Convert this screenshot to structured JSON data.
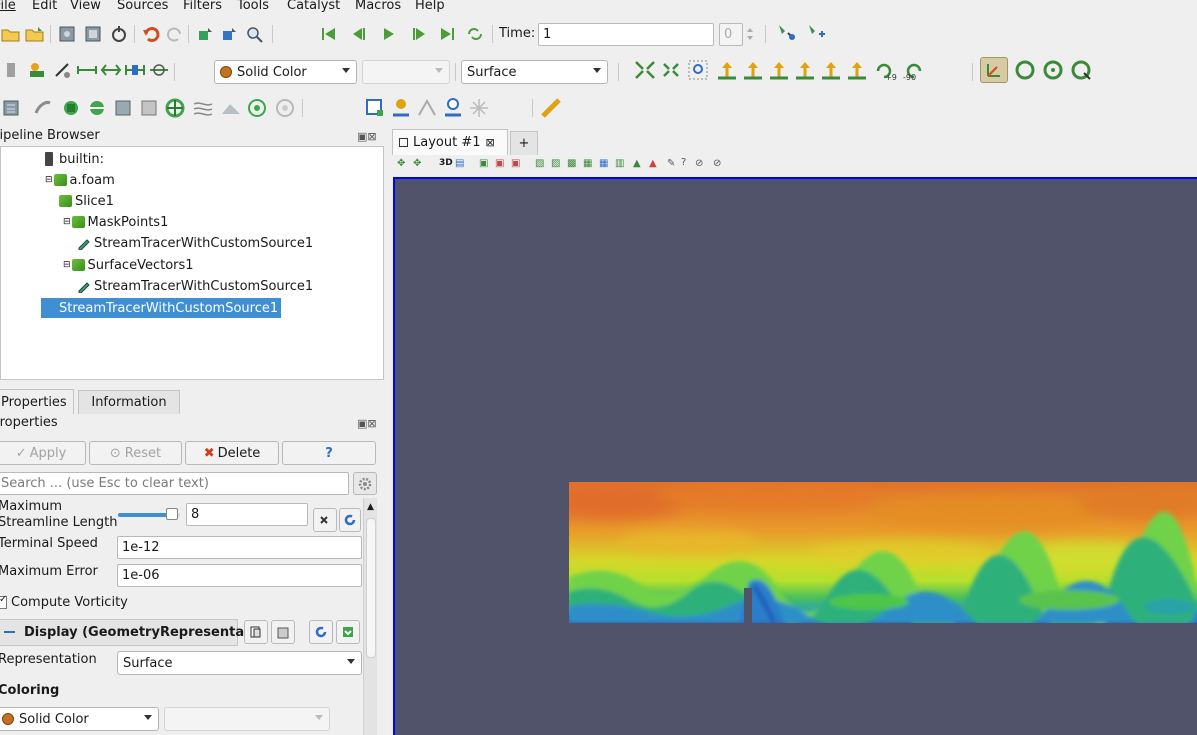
{
  "menu": [
    "File",
    "Edit",
    "View",
    "Sources",
    "Filters",
    "Tools",
    "Catalyst",
    "Macros",
    "Help"
  ],
  "toolbar": {
    "time_label": "Time:",
    "time_value": "1",
    "timestep_value": "0",
    "coloring_value": "Solid Color",
    "representation_value": "Surface",
    "rotate_plus": "+90",
    "rotate_minus": "-90"
  },
  "pipeline": {
    "title": "Pipeline Browser",
    "nodes": [
      "builtin:",
      "a.foam",
      "Slice1",
      "MaskPoints1",
      "StreamTracerWithCustomSource1",
      "SurfaceVectors1",
      "StreamTracerWithCustomSource1",
      "StreamTracerWithCustomSource1"
    ]
  },
  "layout_tabs": {
    "tab1": "Layout #1",
    "add": "+"
  },
  "view_toolbar": {
    "three_d": "3D",
    "question": "?"
  },
  "properties": {
    "tab_properties": "Properties",
    "tab_information": "Information",
    "panel_title": "Properties",
    "apply": "Apply",
    "reset": "Reset",
    "delete": "Delete",
    "help": "?",
    "search_placeholder": "Search ... (use Esc to clear text)",
    "max_len_label_1": "Maximum",
    "max_len_label_2": "Streamline Length",
    "max_len_value": "8",
    "max_len_slider": 0.95,
    "terminal_speed_label": "Terminal Speed",
    "terminal_speed_value": "1e-12",
    "max_error_label": "Maximum Error",
    "max_error_value": "1e-06",
    "vorticity_label": "Compute Vorticity",
    "vorticity_checked": true,
    "display_header": "Display (GeometryRepresenta",
    "representation_label": "Representation",
    "representation_value": "Surface",
    "coloring_header": "Coloring",
    "coloring_value": "Solid Color"
  },
  "colors": {
    "viewport_bg": "#51536a",
    "selection": "#3f8fd2",
    "active_view_border": "#0000ff"
  }
}
